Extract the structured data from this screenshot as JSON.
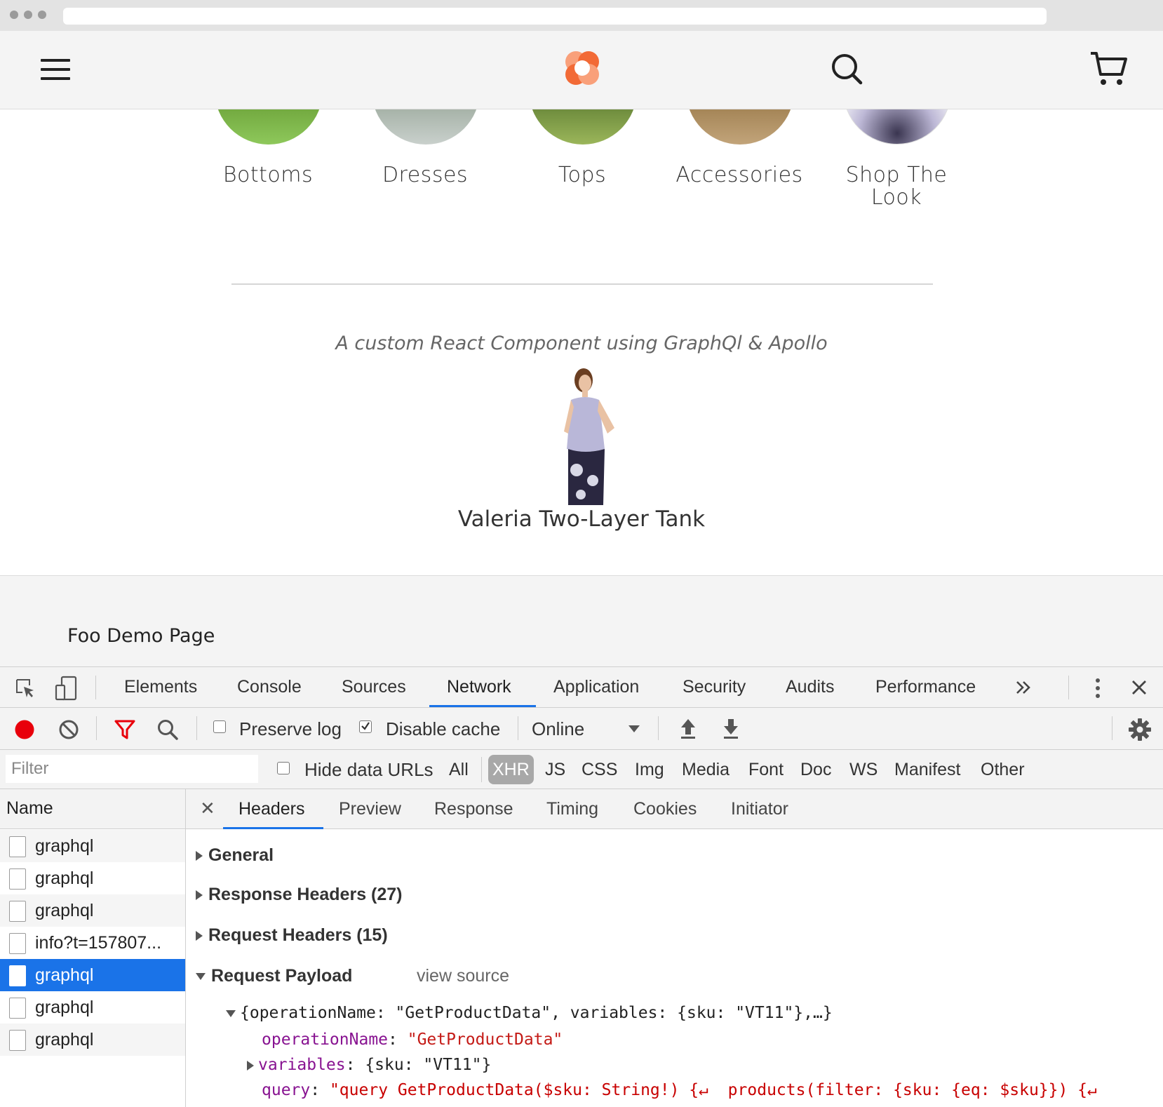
{
  "site": {
    "nav": {
      "menu_icon": "hamburger-icon",
      "logo_icon": "venia-flower-logo",
      "search_icon": "search-icon",
      "cart_icon": "cart-icon"
    },
    "categories": [
      {
        "label": "Bottoms"
      },
      {
        "label": "Dresses"
      },
      {
        "label": "Tops"
      },
      {
        "label": "Accessories"
      },
      {
        "label": "Shop The Look"
      }
    ],
    "section_subtitle": "A custom React Component using GraphQl & Apollo",
    "product": {
      "name": "Valeria Two-Layer Tank"
    },
    "footer_text": "Foo Demo Page",
    "colors": {
      "logo_orange": "#f26a36",
      "logo_light": "#f9a07a"
    }
  },
  "devtools": {
    "tabs": [
      "Elements",
      "Console",
      "Sources",
      "Network",
      "Application",
      "Security",
      "Audits",
      "Performance"
    ],
    "active_tab": "Network",
    "more_tabs_icon": "double-chevron-icon",
    "toolbar": {
      "preserve_log": "Preserve log",
      "preserve_log_checked": false,
      "disable_cache": "Disable cache",
      "disable_cache_checked": true,
      "throttling": "Online"
    },
    "filter": {
      "placeholder": "Filter",
      "hide_data_urls": "Hide data URLs",
      "types": [
        "All",
        "XHR",
        "JS",
        "CSS",
        "Img",
        "Media",
        "Font",
        "Doc",
        "WS",
        "Manifest",
        "Other"
      ],
      "active_type": "XHR"
    },
    "requests_header": "Name",
    "requests": [
      "graphql",
      "graphql",
      "graphql",
      "info?t=157807...",
      "graphql",
      "graphql",
      "graphql"
    ],
    "selected_request_index": 4,
    "detail_tabs": [
      "Headers",
      "Preview",
      "Response",
      "Timing",
      "Cookies",
      "Initiator"
    ],
    "active_detail_tab": "Headers",
    "sections": {
      "general": "General",
      "response_headers": "Response Headers (27)",
      "request_headers": "Request Headers (15)",
      "request_payload": "Request Payload",
      "view_source": "view source"
    },
    "payload": {
      "summary": "{operationName: \"GetProductData\", variables: {sku: \"VT11\"},…}",
      "operation_name_key": "operationName",
      "operation_name_value": "\"GetProductData\"",
      "variables_key": "variables",
      "variables_value": "{sku: \"VT11\"}",
      "query_key": "query",
      "query_value": "\"query GetProductData($sku: String!) {↵  products(filter: {sku: {eq: $sku}}) {↵"
    },
    "colors": {
      "accent": "#1a73e8",
      "record": "#e8000b",
      "filter_icon": "#e8000b"
    }
  }
}
